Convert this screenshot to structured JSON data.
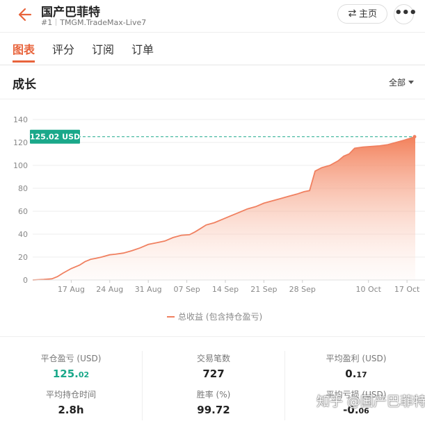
{
  "header": {
    "back_icon": "arrow-left-icon",
    "title": "国产巴菲特",
    "rank": "#1",
    "account": "TMGM.TradeMax-Live7",
    "home_icon": "swap-arrows-icon",
    "home_label": "主页",
    "more_label": "•••"
  },
  "tabs": [
    {
      "label": "图表",
      "active": true
    },
    {
      "label": "评分",
      "active": false
    },
    {
      "label": "订阅",
      "active": false
    },
    {
      "label": "订单",
      "active": false
    }
  ],
  "section": {
    "title": "成长",
    "range_label": "全部"
  },
  "colors": {
    "accent": "#e8643c",
    "line": "#f08060",
    "badge": "#1aa88a"
  },
  "chart_data": {
    "type": "area",
    "title": "",
    "xlabel": "",
    "ylabel": "",
    "ylim": [
      0,
      140
    ],
    "y_ticks": [
      0,
      20,
      40,
      60,
      80,
      100,
      120,
      140
    ],
    "x_tick_labels": [
      "17 Aug",
      "24 Aug",
      "31 Aug",
      "07 Sep",
      "14 Sep",
      "21 Sep",
      "28 Sep",
      "10 Oct",
      "17 Oct"
    ],
    "x_tick_days": [
      7,
      14,
      21,
      28,
      35,
      42,
      49,
      61,
      68
    ],
    "x_range_days": [
      0,
      69.5
    ],
    "grid": "horizontal",
    "current_value_label": "125.02 USD",
    "current_value": 125.02,
    "legend_position": "bottom-center",
    "series": [
      {
        "name": "总收益 (包含持仓盈亏)",
        "x_days": [
          0,
          2,
          3.5,
          4.5,
          5.5,
          7,
          8.5,
          9.5,
          10.5,
          11.5,
          12.5,
          14,
          15,
          16.5,
          18,
          19.5,
          21,
          22.5,
          24,
          25.5,
          27,
          28.5,
          29.5,
          30.5,
          31.5,
          33,
          34.5,
          36,
          37.5,
          39,
          40.5,
          42,
          43.5,
          45,
          46.5,
          48,
          49.3,
          50.3,
          51.3,
          52.5,
          54,
          55.5,
          56.5,
          57.5,
          58.5,
          60,
          61.5,
          63,
          64.5,
          66,
          67.5,
          69.5
        ],
        "values": [
          0,
          0.5,
          1,
          3,
          6,
          10,
          13,
          16,
          18,
          19,
          20,
          22,
          22.5,
          23.5,
          25.5,
          28,
          31,
          32.5,
          34,
          37,
          39,
          39.5,
          42,
          45,
          48,
          50,
          53,
          56,
          59,
          62,
          64,
          67,
          69,
          71,
          73,
          75,
          77,
          78,
          95,
          98,
          100,
          104,
          108,
          110,
          115,
          116,
          116.5,
          117,
          118,
          120,
          122,
          125.02
        ]
      }
    ]
  },
  "stats": [
    {
      "label": "平仓盈亏 (USD)",
      "value_main": "125.",
      "value_small": "02",
      "color": "green"
    },
    {
      "label": "交易笔数",
      "value_main": "727",
      "value_small": "",
      "color": "default"
    },
    {
      "label": "平均盈利 (USD)",
      "value_main": "0.",
      "value_small": "17",
      "color": "default"
    },
    {
      "label": "平均持仓时间",
      "value_main": "2.8h",
      "value_small": "",
      "color": "default"
    },
    {
      "label": "胜率 (%)",
      "value_main": "99.72",
      "value_small": "",
      "color": "default"
    },
    {
      "label": "平均亏损 (USD)",
      "value_main": "-0.",
      "value_small": "06",
      "color": "default"
    }
  ],
  "watermark": "知乎 @国产巴菲特"
}
